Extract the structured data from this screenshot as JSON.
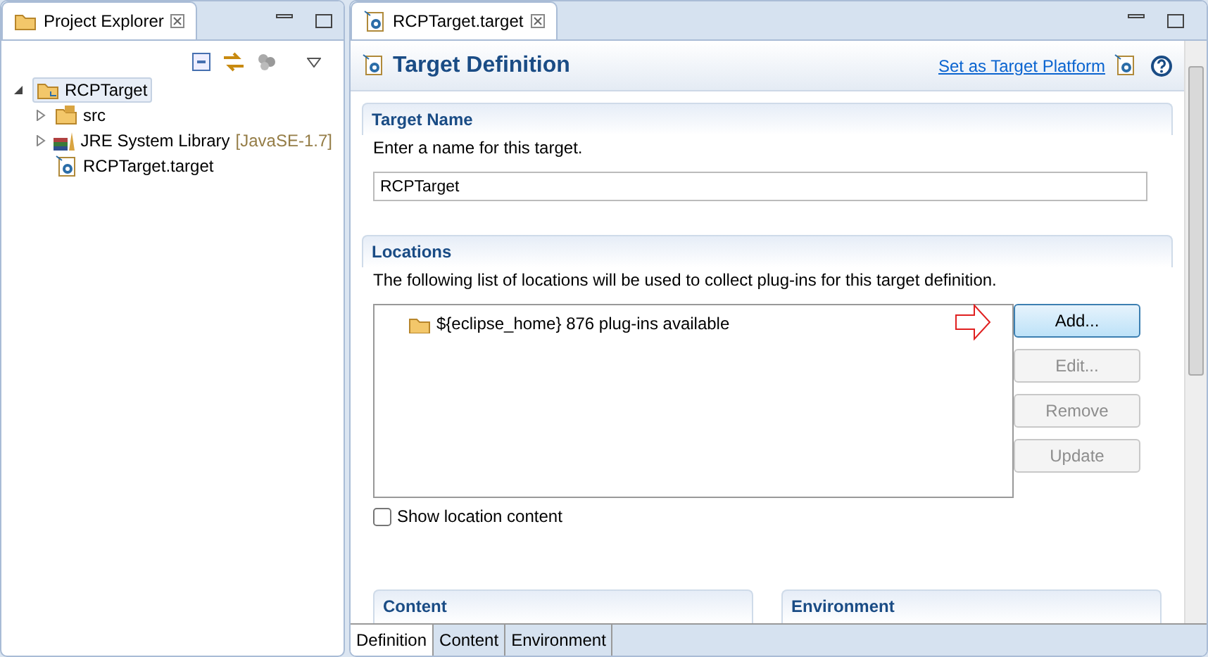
{
  "explorer": {
    "title": "Project Explorer",
    "tree": [
      {
        "label": "RCPTarget",
        "kind": "project",
        "selected": true,
        "expanded": true,
        "children": [
          {
            "label": "src",
            "kind": "source",
            "selected": false,
            "expanded": false
          },
          {
            "label": "JRE System Library",
            "decoration": "[JavaSE-1.7]",
            "kind": "library",
            "selected": false,
            "expanded": false
          },
          {
            "label": "RCPTarget.target",
            "kind": "target",
            "selected": false
          }
        ]
      }
    ]
  },
  "editor": {
    "tab": "RCPTarget.target",
    "title": "Target Definition",
    "link": "Set as Target Platform",
    "target_name": {
      "heading": "Target Name",
      "description": "Enter a name for this target.",
      "value": "RCPTarget"
    },
    "locations": {
      "heading": "Locations",
      "description": "The following list of locations will be used to collect plug-ins for this target definition.",
      "items": [
        {
          "label": "${eclipse_home} 876 plug-ins available"
        }
      ],
      "buttons": [
        {
          "label": "Add...",
          "disabled": false
        },
        {
          "label": "Edit...",
          "disabled": true
        },
        {
          "label": "Remove",
          "disabled": true
        },
        {
          "label": "Update",
          "disabled": true
        }
      ],
      "show_content": {
        "label": "Show location content",
        "checked": false
      }
    },
    "sections": [
      "Content",
      "Environment"
    ],
    "pages": [
      {
        "label": "Definition",
        "selected": true
      },
      {
        "label": "Content",
        "selected": false
      },
      {
        "label": "Environment",
        "selected": false
      }
    ]
  }
}
